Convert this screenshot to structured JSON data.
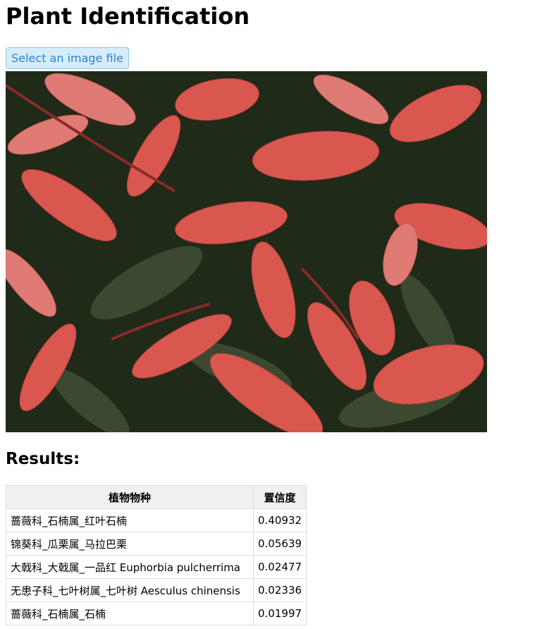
{
  "page": {
    "title": "Plant Identification",
    "select_button_label": "Select an image file",
    "results_heading": "Results:"
  },
  "preview_image": {
    "description_icon": "photo-red-leaf-plant",
    "colors": {
      "background": "#1f2a19",
      "leaf_red": "#d9574f",
      "leaf_pink": "#e07a74",
      "leaf_dark": "#3e4d33"
    }
  },
  "results_table": {
    "headers": [
      "植物物种",
      "置信度"
    ],
    "rows": [
      {
        "species": "蔷薇科_石楠属_红叶石楠",
        "confidence": "0.40932"
      },
      {
        "species": "锦葵科_瓜栗属_马拉巴栗",
        "confidence": "0.05639"
      },
      {
        "species": "大戟科_大戟属_一品红 Euphorbia pulcherrima",
        "confidence": "0.02477"
      },
      {
        "species": "无患子科_七叶树属_七叶树 Aesculus chinensis",
        "confidence": "0.02336"
      },
      {
        "species": "蔷薇科_石楠属_石楠",
        "confidence": "0.01997"
      }
    ]
  }
}
